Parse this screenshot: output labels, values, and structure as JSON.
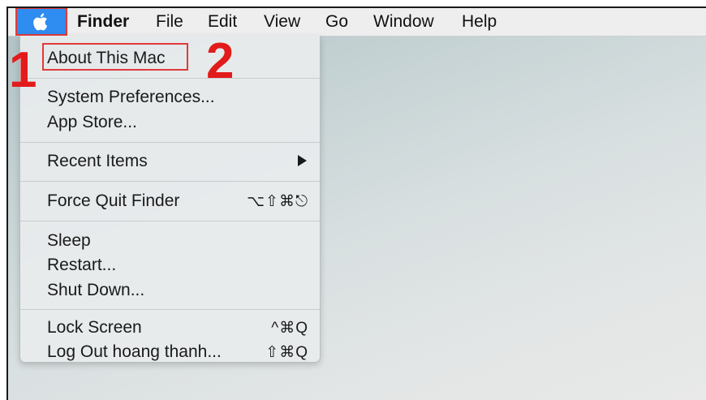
{
  "menubar": {
    "apple_icon": "apple-icon",
    "items": [
      {
        "label": "Finder"
      },
      {
        "label": "File"
      },
      {
        "label": "Edit"
      },
      {
        "label": "View"
      },
      {
        "label": "Go"
      },
      {
        "label": "Window"
      },
      {
        "label": "Help"
      }
    ]
  },
  "apple_menu": {
    "items": [
      {
        "label": "About This Mac",
        "shortcut": ""
      },
      {
        "label": "System Preferences...",
        "shortcut": ""
      },
      {
        "label": "App Store...",
        "shortcut": ""
      },
      {
        "label": "Recent Items",
        "shortcut": "",
        "submenu_icon": "triangle-right-icon"
      },
      {
        "label": "Force Quit Finder",
        "shortcut": "⌥⇧⌘⎋"
      },
      {
        "label": "Sleep",
        "shortcut": ""
      },
      {
        "label": "Restart...",
        "shortcut": ""
      },
      {
        "label": "Shut Down...",
        "shortcut": ""
      },
      {
        "label": "Lock Screen",
        "shortcut": "^⌘Q"
      },
      {
        "label": "Log Out hoang thanh...",
        "shortcut": "⇧⌘Q"
      }
    ]
  },
  "annotations": {
    "step1": "1",
    "step2": "2",
    "highlight_color": "#e03a3a"
  },
  "colors": {
    "apple_selected": "#2f8cf0",
    "step_number": "#e21b1b"
  }
}
